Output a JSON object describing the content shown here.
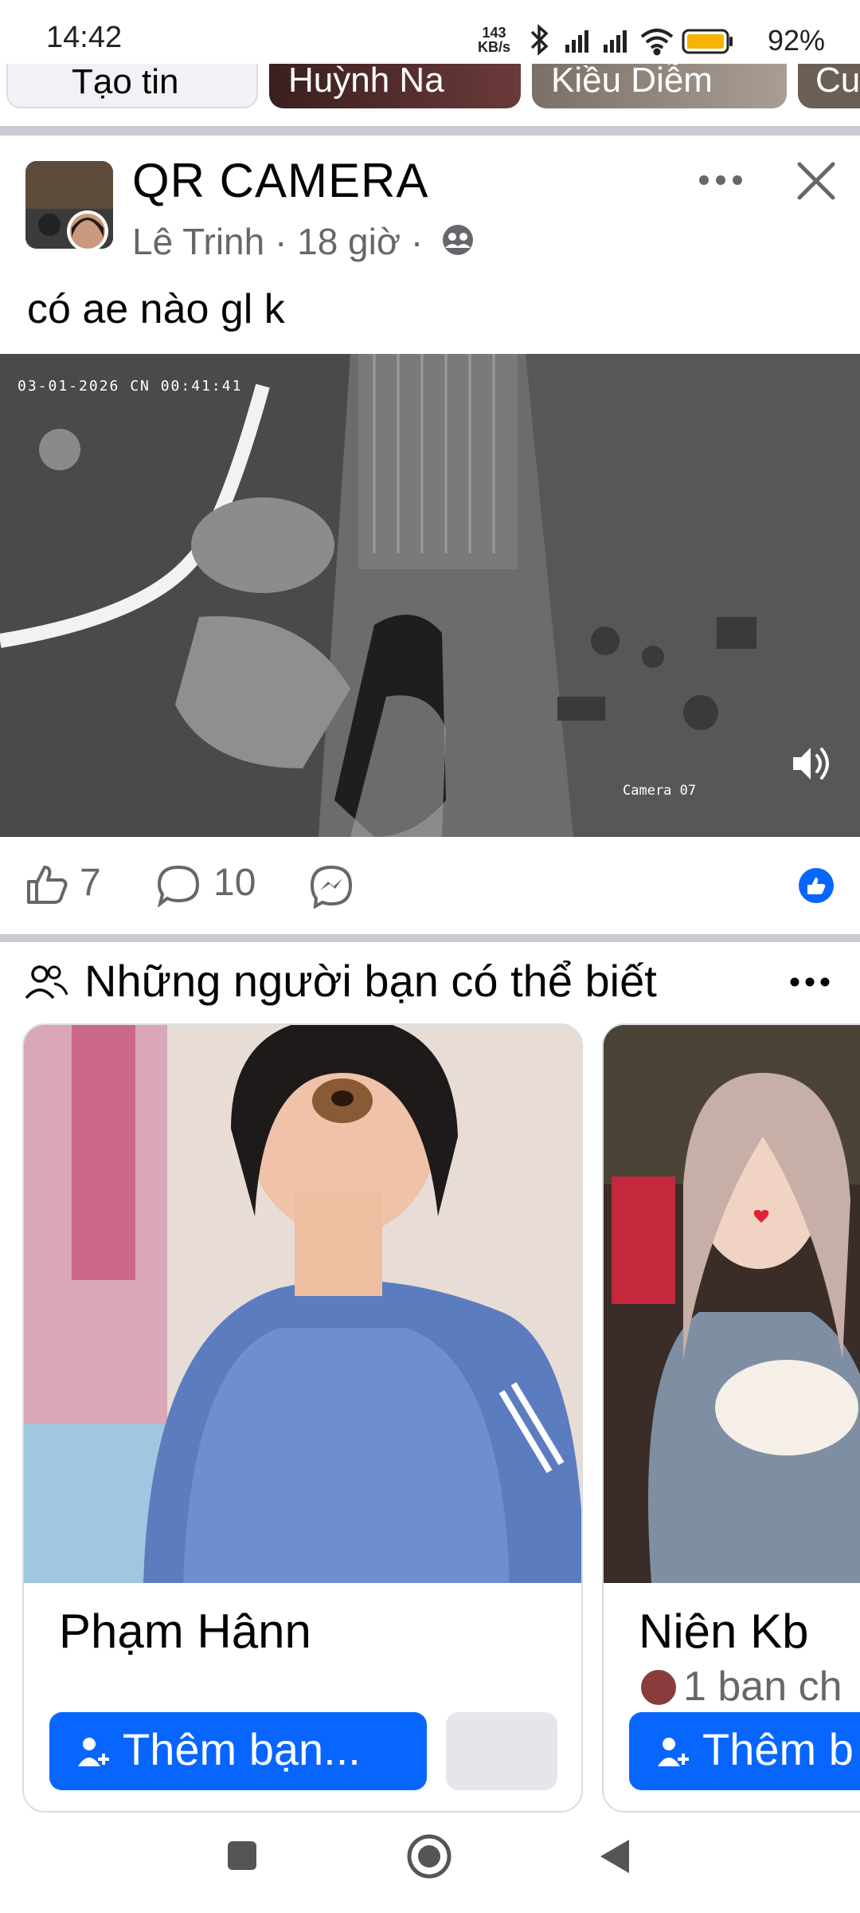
{
  "status_bar": {
    "time": "14:42",
    "net_speed_value": "143",
    "net_speed_unit": "KB/s",
    "battery": "92%"
  },
  "stories": [
    {
      "label": "Tạo tin"
    },
    {
      "label": "Huỳnh Na"
    },
    {
      "label": "Kiều Diễm"
    },
    {
      "label": "Cu"
    }
  ],
  "post": {
    "group": "QR CAMERA",
    "author": "Lê Trinh",
    "time": "18 giờ",
    "separator": "·",
    "text": "có ae nào gl k",
    "video_timestamp": "03-01-2026 CN  00:41:41",
    "video_camera_label": "Camera 07",
    "likes": "7",
    "comments": "10"
  },
  "friends_section": {
    "title": "Những người bạn có thể biết",
    "cards": [
      {
        "name": "Phạm Hânn",
        "mutual": "",
        "add_label": "Thêm bạn..."
      },
      {
        "name": "Niên Kb",
        "mutual": "1 ban ch",
        "add_label": "Thêm b"
      }
    ]
  },
  "colors": {
    "brand_blue": "#0866ff",
    "secondary_text": "#65676b",
    "separator": "#c9ccd1"
  },
  "icons": {
    "more": "more-horizontal-icon",
    "close": "close-icon",
    "privacy": "friends-privacy-icon",
    "like": "like-icon",
    "comment": "comment-icon",
    "messenger": "messenger-icon",
    "sound": "volume-icon",
    "people": "people-icon",
    "add_friend": "person-add-icon"
  }
}
